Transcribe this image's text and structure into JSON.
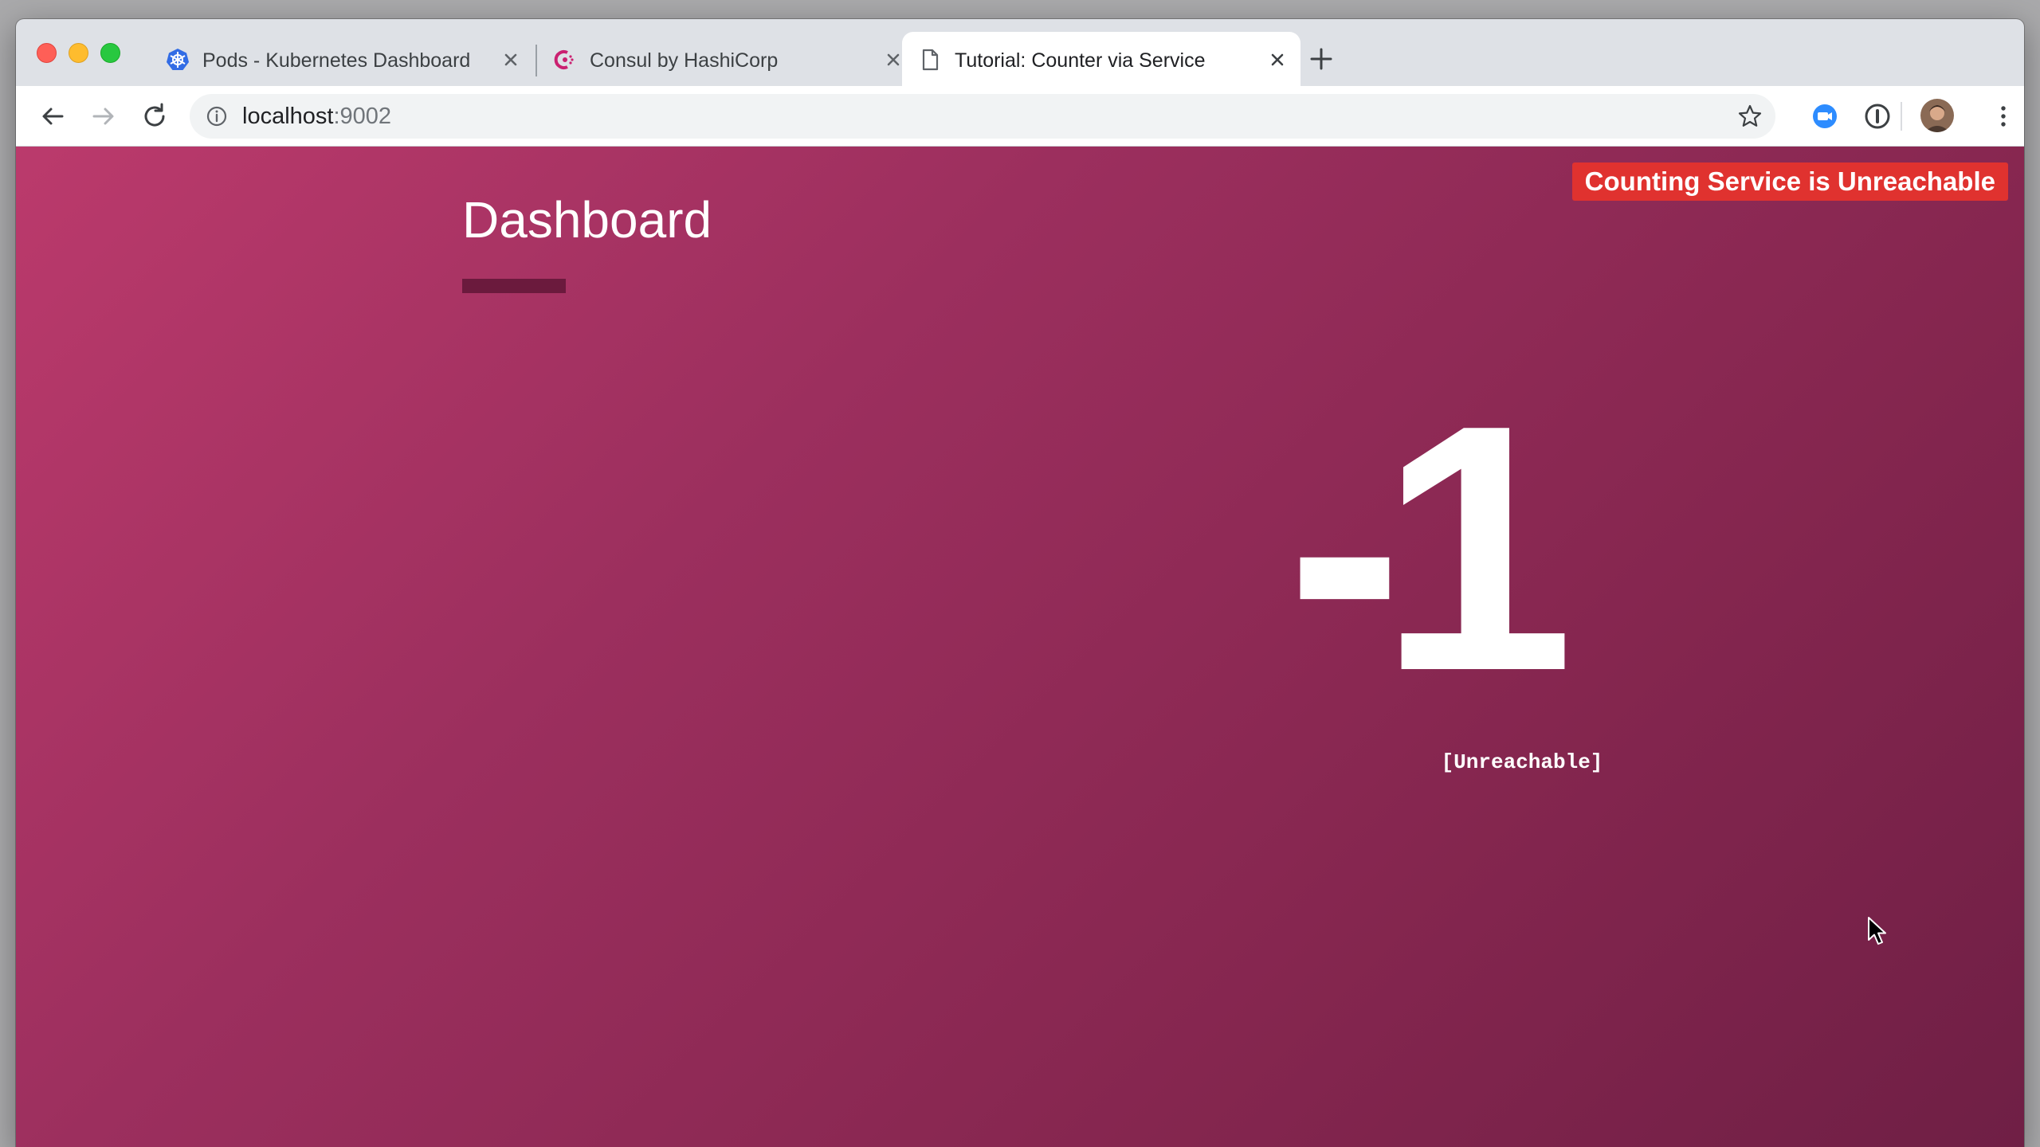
{
  "browser": {
    "tabs": [
      {
        "title": "Pods - Kubernetes Dashboard",
        "icon": "kubernetes-icon",
        "active": false
      },
      {
        "title": "Consul by HashiCorp",
        "icon": "consul-icon",
        "active": false
      },
      {
        "title": "Tutorial: Counter via Service",
        "icon": "document-icon",
        "active": true
      }
    ],
    "address": {
      "host": "localhost",
      "port": ":9002"
    },
    "colors": {
      "tab_strip": "#dee1e6",
      "toolbar": "#ffffff",
      "omnibox": "#f1f3f4"
    }
  },
  "page": {
    "alert": "Counting Service is Unreachable",
    "title": "Dashboard",
    "counter_value": "-1",
    "counter_status": "[Unreachable]",
    "colors": {
      "gradient_start": "#bb3a6c",
      "gradient_end": "#6f1f45",
      "alert_bg": "#e0322f",
      "title_bar": "#6b1a3d"
    }
  }
}
